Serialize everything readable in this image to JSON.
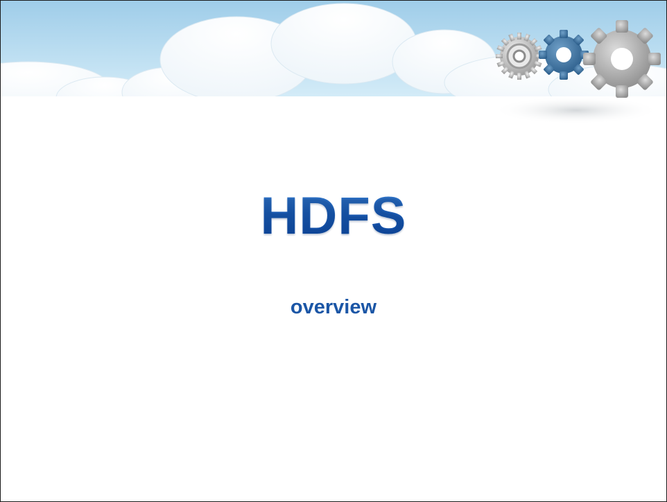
{
  "slide": {
    "title": "HDFS",
    "subtitle": "overview"
  },
  "decorations": {
    "background": "sky-with-clouds",
    "gears": [
      "gear-icon-small-silver",
      "gear-icon-blue",
      "gear-icon-large-gray"
    ]
  },
  "colors": {
    "title": "#1c5db5",
    "subtitle": "#1b56a6",
    "sky": "#b8dbef",
    "cloud": "#ffffff"
  }
}
